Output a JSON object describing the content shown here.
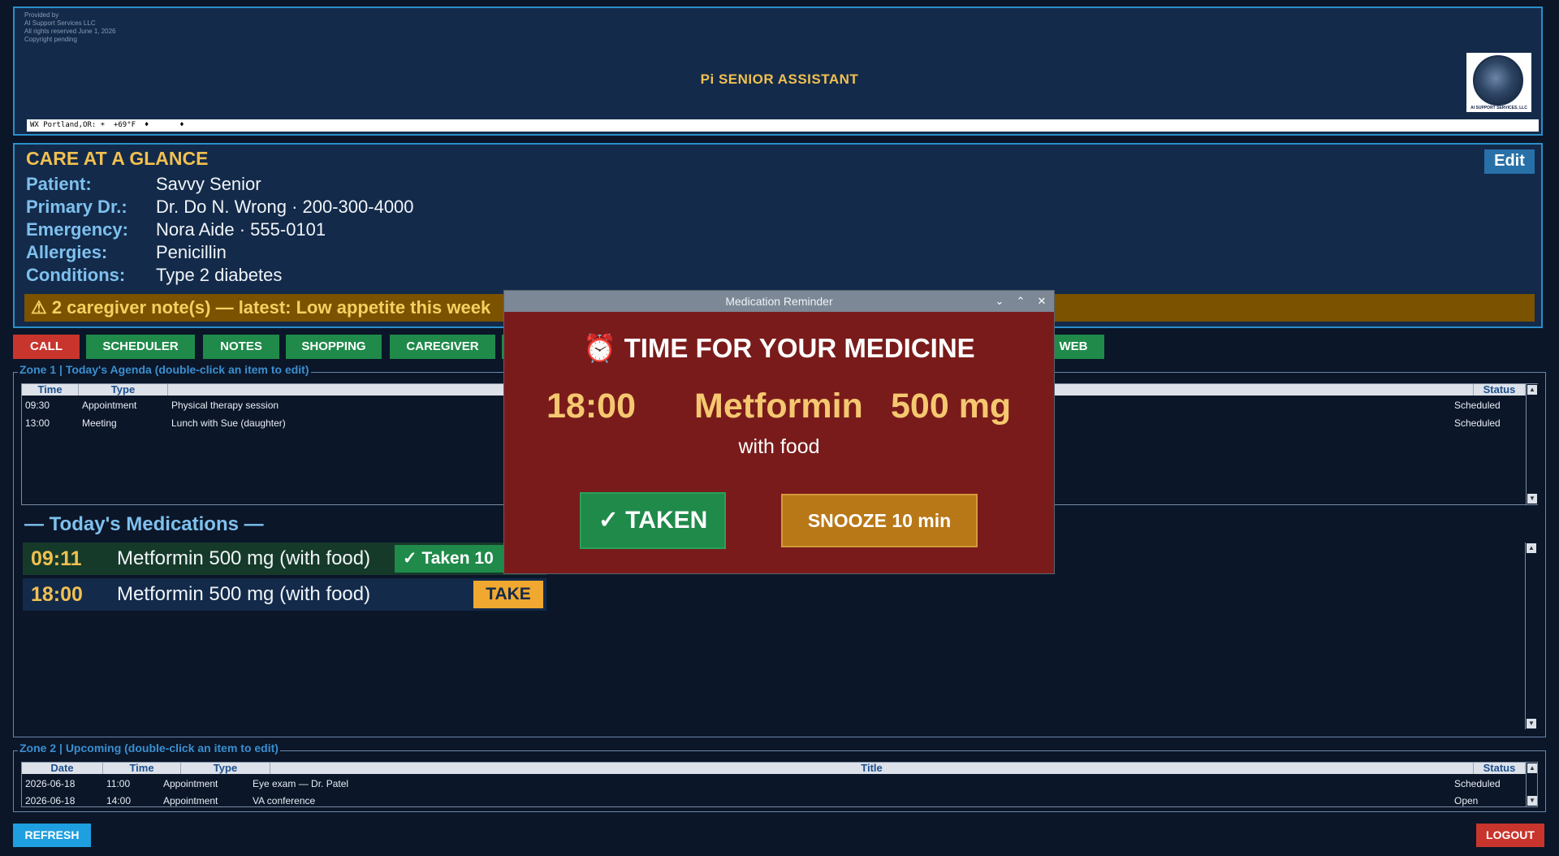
{
  "header": {
    "provided_by": "Provided by\nAI Support Services LLC\nAll rights reserved  June 1, 2026\nCopyright pending",
    "title": "Pi SENIOR ASSISTANT",
    "logo_text": "AI SUPPORT SERVICES, LLC",
    "ticker": "WX Portland,OR: ☀  +69°F  ♦       ♦"
  },
  "care": {
    "title": "CARE AT A GLANCE",
    "edit_label": "Edit",
    "fields": [
      {
        "label": "Patient:",
        "value": "Savvy Senior"
      },
      {
        "label": "Primary Dr.:",
        "value": "Dr. Do N. Wrong · 200-300-4000"
      },
      {
        "label": "Emergency:",
        "value": "Nora Aide · 555-0101"
      },
      {
        "label": "Allergies:",
        "value": "Penicillin"
      },
      {
        "label": "Conditions:",
        "value": "Type 2 diabetes"
      }
    ],
    "notes_alert": "⚠ 2 caregiver note(s) — latest: Low appetite this week"
  },
  "nav": {
    "call": "CALL",
    "scheduler": "SCHEDULER",
    "notes": "NOTES",
    "shopping": "SHOPPING",
    "caregiver": "CAREGIVER",
    "web": "WEB"
  },
  "zone1": {
    "label": "Zone 1 | Today's Agenda  (double-click an item to edit)",
    "headers": {
      "time": "Time",
      "type": "Type",
      "status": "Status"
    },
    "rows": [
      {
        "time": "09:30",
        "type": "Appointment",
        "title": "Physical therapy session",
        "status": "Scheduled"
      },
      {
        "time": "13:00",
        "type": "Meeting",
        "title": "Lunch with Sue (daughter)",
        "status": "Scheduled"
      }
    ]
  },
  "meds": {
    "title": "— Today's Medications —",
    "rows": [
      {
        "time": "09:11",
        "name": "Metformin 500 mg  (with food)",
        "action": "✓ Taken 10"
      },
      {
        "time": "18:00",
        "name": "Metformin 500 mg  (with food)",
        "action": "TAKE"
      }
    ]
  },
  "zone2": {
    "label": "Zone 2 | Upcoming  (double-click an item to edit)",
    "headers": {
      "date": "Date",
      "time": "Time",
      "type": "Type",
      "title": "Title",
      "status": "Status"
    },
    "rows": [
      {
        "date": "2026-06-18",
        "time": "11:00",
        "type": "Appointment",
        "title": "Eye exam — Dr. Patel",
        "status": "Scheduled"
      },
      {
        "date": "2026-06-18",
        "time": "14:00",
        "type": "Appointment",
        "title": "VA conference",
        "status": "Open"
      }
    ]
  },
  "modal": {
    "window_title": "Medication Reminder",
    "headline": "⏰ TIME FOR YOUR MEDICINE",
    "time": "18:00",
    "drug": "Metformin",
    "dose": "500 mg",
    "instructions": "with food",
    "taken_label": "✓  TAKEN",
    "snooze_label": "SNOOZE 10 min",
    "minimize": "⌄",
    "maximize": "⌃",
    "close": "✕"
  },
  "footer": {
    "refresh": "REFRESH",
    "logout": "LOGOUT"
  },
  "colors": {
    "background": "#0b1628",
    "accent_gold": "#f0c050",
    "accent_blue": "#7ec0ee",
    "modal_bg": "#7a1b1b",
    "taken_green": "#1f8a4a",
    "snooze_orange": "#b87818",
    "danger_red": "#c8352c"
  }
}
